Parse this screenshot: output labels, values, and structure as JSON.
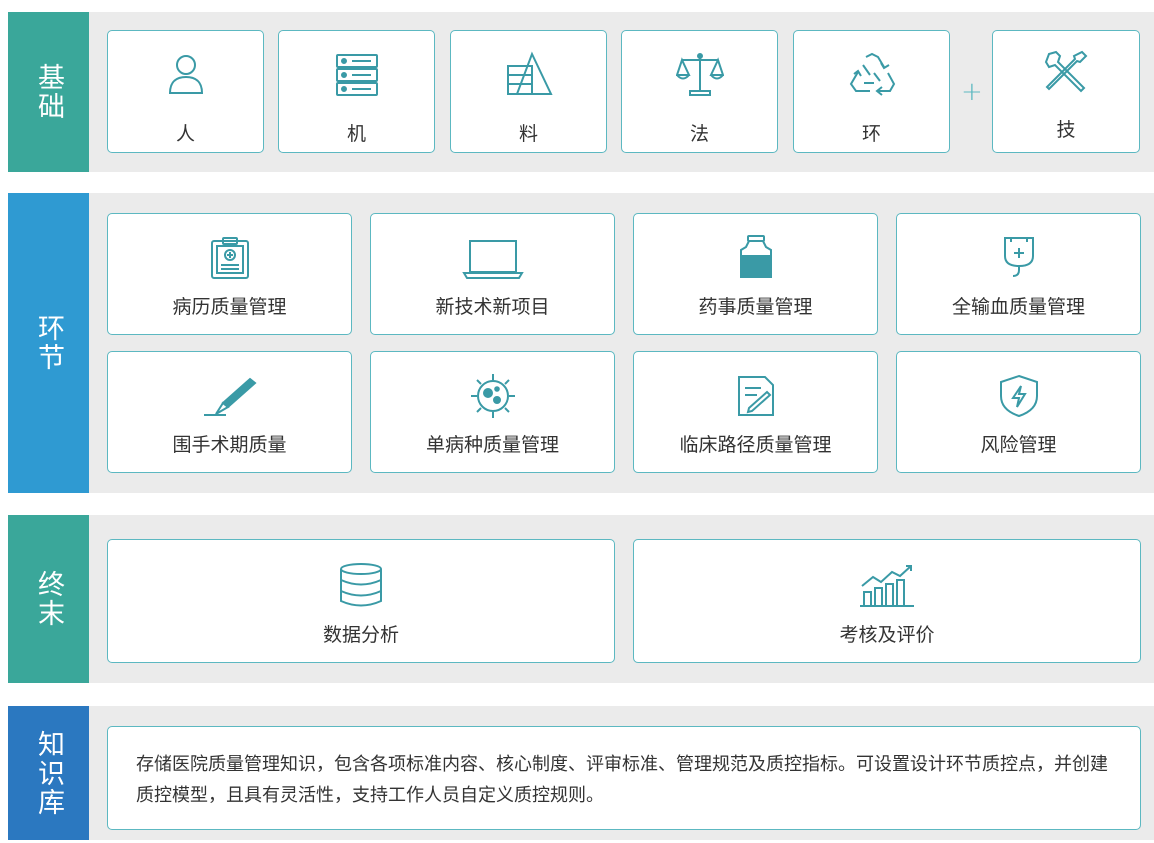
{
  "colors": {
    "foundation": "#3aa79a",
    "links": "#2f9ad2",
    "terminal": "#3aa79a",
    "knowledge": "#2b78c0",
    "card_border": "#5cb8c1",
    "icon": "#3a9aa6"
  },
  "sections": {
    "foundation": {
      "tag": "基础",
      "items": [
        {
          "label": "人",
          "icon": "person-icon"
        },
        {
          "label": "机",
          "icon": "server-icon"
        },
        {
          "label": "料",
          "icon": "material-icon"
        },
        {
          "label": "法",
          "icon": "scale-icon"
        },
        {
          "label": "环",
          "icon": "recycle-icon"
        }
      ],
      "plus": "+",
      "extra": {
        "label": "技",
        "icon": "tools-icon"
      }
    },
    "links": {
      "tag": "环节",
      "items": [
        {
          "label": "病历质量管理",
          "icon": "clipboard-icon"
        },
        {
          "label": "新技术新项目",
          "icon": "laptop-icon"
        },
        {
          "label": "药事质量管理",
          "icon": "medicine-bottle-icon"
        },
        {
          "label": "全输血质量管理",
          "icon": "blood-bag-icon"
        },
        {
          "label": "围手术期质量",
          "icon": "scalpel-icon"
        },
        {
          "label": "单病种质量管理",
          "icon": "virus-icon"
        },
        {
          "label": "临床路径质量管理",
          "icon": "document-edit-icon"
        },
        {
          "label": "风险管理",
          "icon": "shield-bolt-icon"
        }
      ]
    },
    "terminal": {
      "tag": "终末",
      "items": [
        {
          "label": "数据分析",
          "icon": "database-icon"
        },
        {
          "label": "考核及评价",
          "icon": "bar-chart-icon"
        }
      ]
    },
    "knowledge": {
      "tag": "知识库",
      "text": "存储医院质量管理知识，包含各项标准内容、核心制度、评审标准、管理规范及质控指标。可设置设计环节质控点，并创建质控模型，且具有灵活性，支持工作人员自定义质控规则。"
    }
  }
}
